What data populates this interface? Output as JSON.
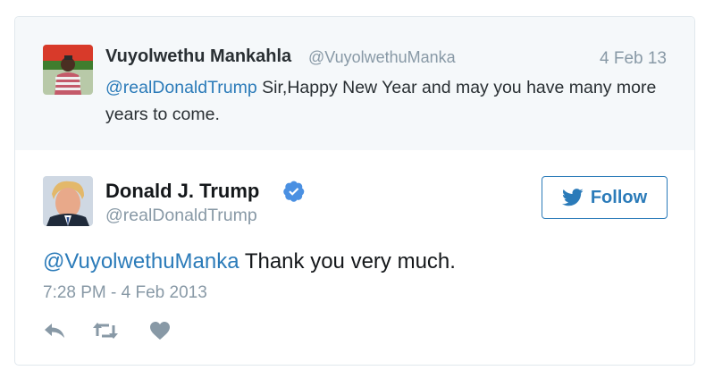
{
  "in_reply_to": {
    "name": "Vuyolwethu Mankahla",
    "handle": "@VuyolwethuManka",
    "date": "4 Feb 13",
    "mention": "@realDonaldTrump",
    "text": " Sir,Happy New Year and may you have many more years to come."
  },
  "tweet": {
    "name": "Donald J. Trump",
    "handle": "@realDonaldTrump",
    "mention": "@VuyolwethuManka",
    "text": " Thank you very much.",
    "timestamp": "7:28 PM - 4 Feb 2013"
  },
  "follow_label": "Follow",
  "icons": {
    "verified": "verified-badge-icon",
    "follow": "twitter-bird-icon",
    "reply": "reply-icon",
    "retweet": "retweet-icon",
    "like": "heart-icon"
  },
  "colors": {
    "link": "#2b7bb9",
    "muted": "#8899a6",
    "reply_bg": "#f5f8fa",
    "border": "#e1e8ed"
  }
}
